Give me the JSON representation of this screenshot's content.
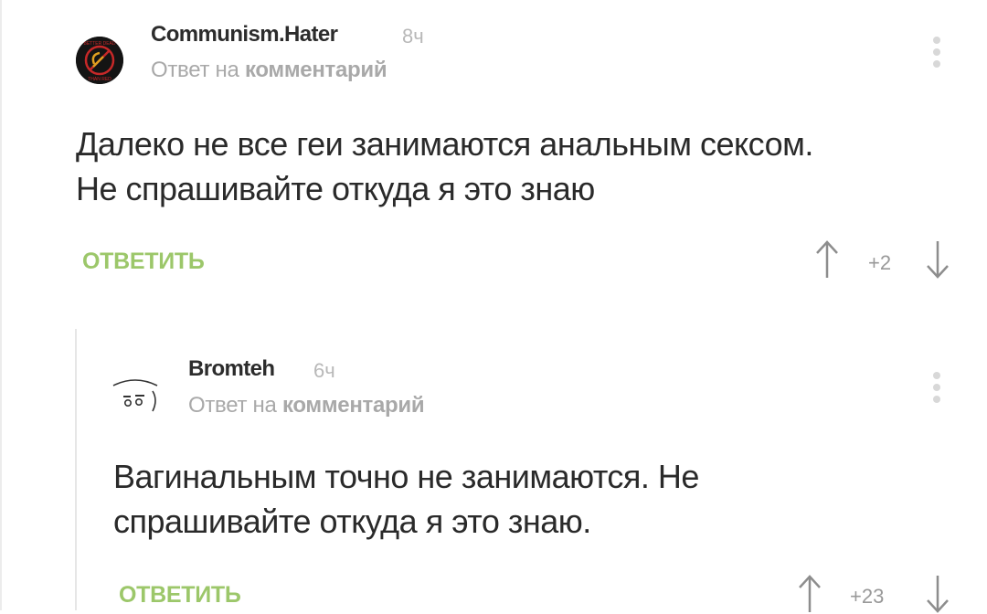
{
  "comments": [
    {
      "author": "Communism.Hater",
      "time": "8ч",
      "reply_prefix": "Ответ на",
      "reply_target": "комментарий",
      "body_lines": [
        "Далеко не все геи занимаются анальным сексом.",
        "Не спрашивайте откуда я это знаю"
      ],
      "reply_label": "ОТВЕТИТЬ",
      "score": "+2",
      "avatar_text": [
        "BETTER DEAD",
        "THAN RED"
      ],
      "icons": {
        "avatar": "avatar-hammer-sickle-icon",
        "menu": "more-vertical-icon",
        "upvote": "arrow-up-icon",
        "downvote": "arrow-down-icon"
      }
    },
    {
      "author": "Bromteh",
      "time": "6ч",
      "reply_prefix": "Ответ на",
      "reply_target": "комментарий",
      "body_lines": [
        "Вагинальным точно не занимаются. Не",
        "спрашивайте откуда я это знаю."
      ],
      "reply_label": "ОТВЕТИТЬ",
      "score": "+23",
      "icons": {
        "avatar": "avatar-sketch-face-icon",
        "menu": "more-vertical-icon",
        "upvote": "arrow-up-icon",
        "downvote": "arrow-down-icon"
      }
    }
  ],
  "colors": {
    "accent_green": "#9cc76a",
    "muted_text": "#a9a9a9",
    "body_text": "#2a2a2a",
    "thread_line": "#e6e6e6"
  }
}
